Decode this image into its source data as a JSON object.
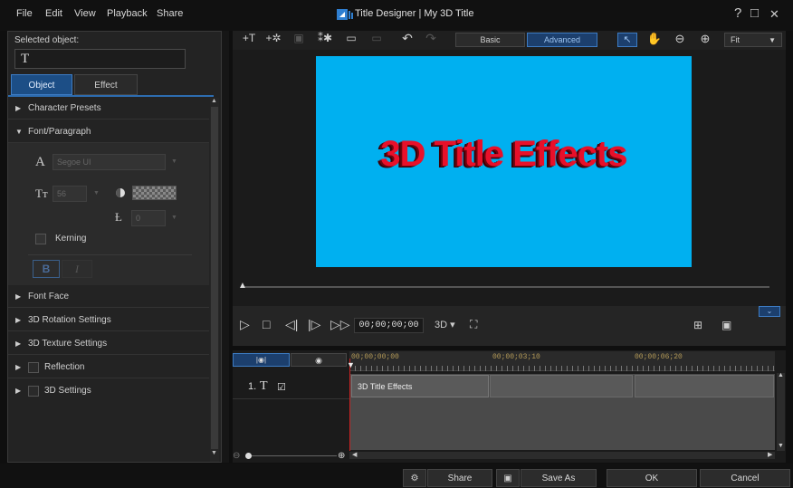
{
  "menu": [
    "File",
    "Edit",
    "View",
    "Playback",
    "Share"
  ],
  "window": {
    "title": "Title Designer  |  My 3D Title",
    "help": "?",
    "maximize": "□",
    "close": "✕"
  },
  "left_panel": {
    "selected_label": "Selected object:",
    "selected_value": "T",
    "tabs": [
      "Object",
      "Effect"
    ],
    "active_tab": "Object",
    "sections": {
      "character_presets": "Character Presets",
      "font_paragraph": "Font/Paragraph",
      "font_face": "Font Face",
      "rotation": "3D Rotation Settings",
      "texture": "3D Texture Settings",
      "reflection": "Reflection",
      "settings_3d": "3D Settings"
    },
    "font": {
      "family": "Segoe UI",
      "size": "56",
      "spacing": "0",
      "kerning_label": "Kerning",
      "bold": "B",
      "italic": "I"
    }
  },
  "toolbar": {
    "mode_basic": "Basic",
    "mode_advanced": "Advanced",
    "active_mode": "Advanced",
    "zoom": "Fit"
  },
  "preview": {
    "title_text": "3D Title Effects",
    "canvas_color": "#00b0f0",
    "text_color": "#e8102a"
  },
  "playback": {
    "timecode": "00;00;00;00",
    "mode_3d": "3D ▾"
  },
  "timeline": {
    "ruler": [
      "00;00;00;00",
      "00;00;03;10",
      "00;00;06;20"
    ],
    "track_number": "1.",
    "track_icon": "T",
    "track_check": "☑",
    "clip_label": "3D Title Effects"
  },
  "footer": {
    "share": "Share",
    "save_as": "Save As",
    "ok": "OK",
    "cancel": "Cancel"
  },
  "accent_color": "#3d7cc4"
}
